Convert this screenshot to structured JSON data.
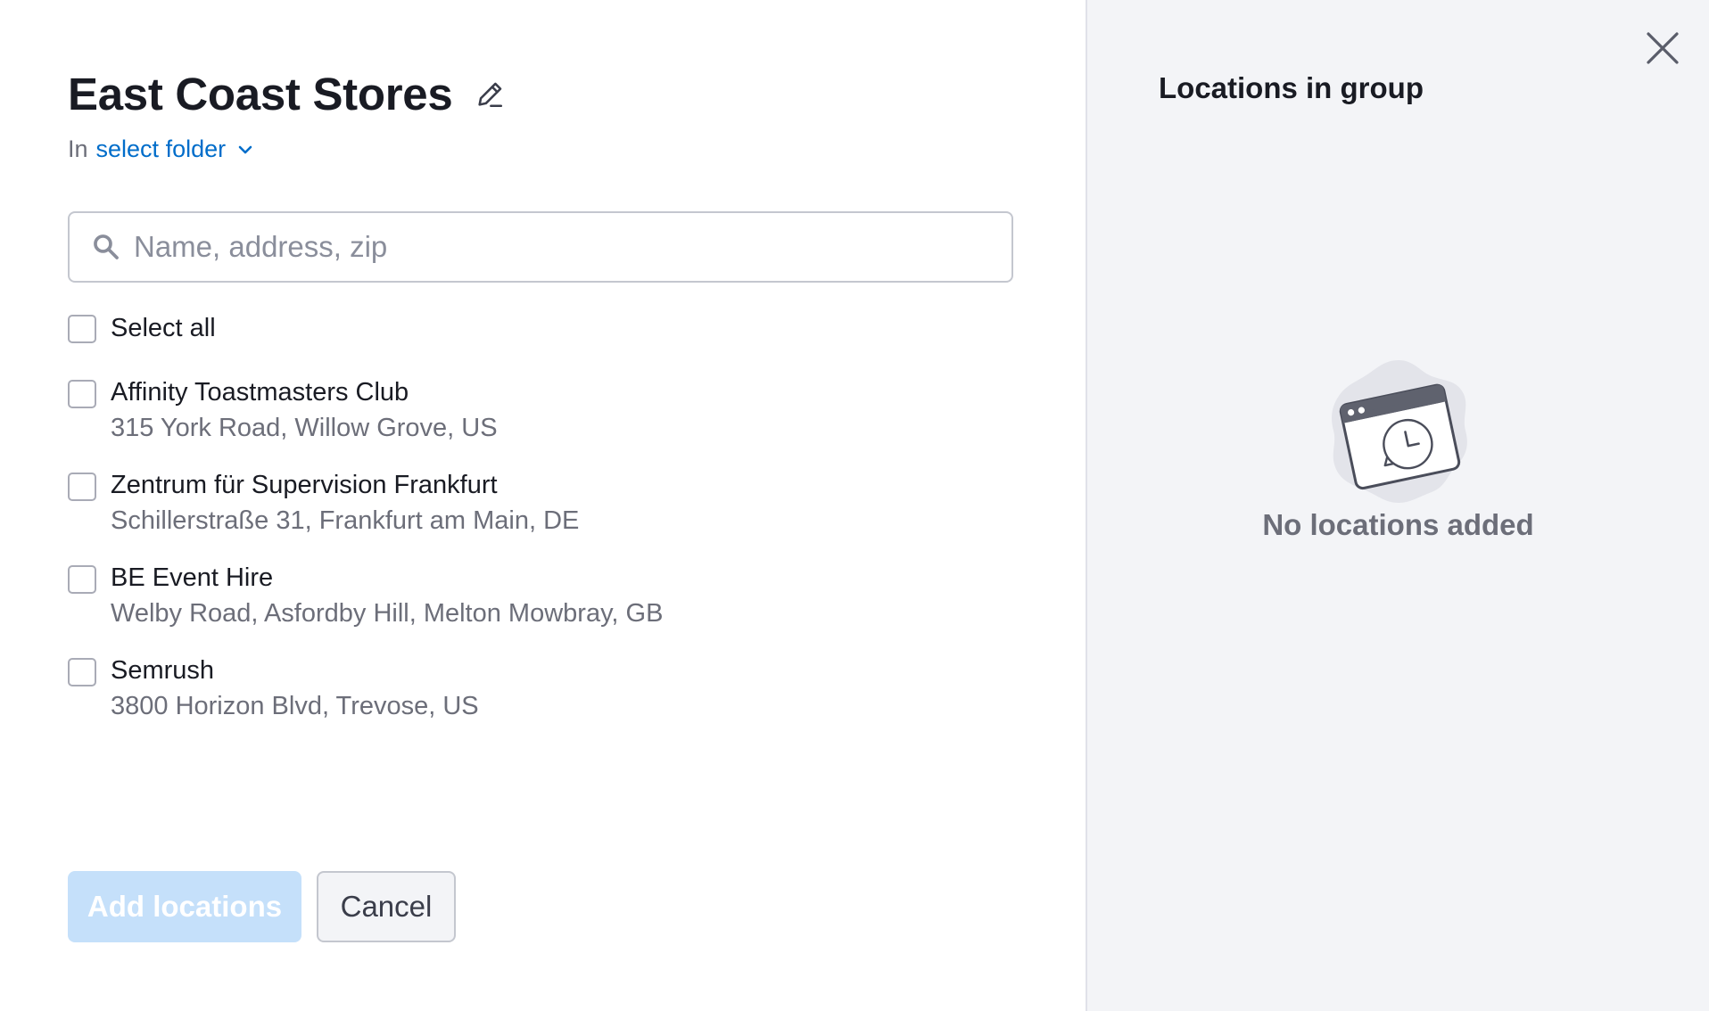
{
  "dialog": {
    "title": "East Coast Stores",
    "folder_prefix": "In",
    "folder_link": "select folder"
  },
  "search": {
    "placeholder": "Name, address, zip",
    "value": ""
  },
  "select_all_label": "Select all",
  "locations": [
    {
      "name": "Affinity Toastmasters Club",
      "address": "315 York Road, Willow Grove, US"
    },
    {
      "name": "Zentrum für Supervision Frankfurt",
      "address": "Schillerstraße 31, Frankfurt am Main, DE"
    },
    {
      "name": "BE Event Hire",
      "address": "Welby Road, Asfordby Hill, Melton Mowbray, GB"
    },
    {
      "name": "Semrush",
      "address": "3800 Horizon Blvd, Trevose, US"
    }
  ],
  "buttons": {
    "add_label": "Add locations",
    "cancel_label": "Cancel"
  },
  "right_panel": {
    "title": "Locations in group",
    "empty_text": "No locations added"
  },
  "icons": {
    "edit": "pencil-icon",
    "folder_chevron": "chevron-down-icon",
    "search": "search-icon",
    "close": "close-icon",
    "empty": "calendar-clock-illustration"
  },
  "colors": {
    "link": "#006dca",
    "primary_disabled": "#c5e0fa",
    "panel_bg": "#f3f4f7"
  }
}
